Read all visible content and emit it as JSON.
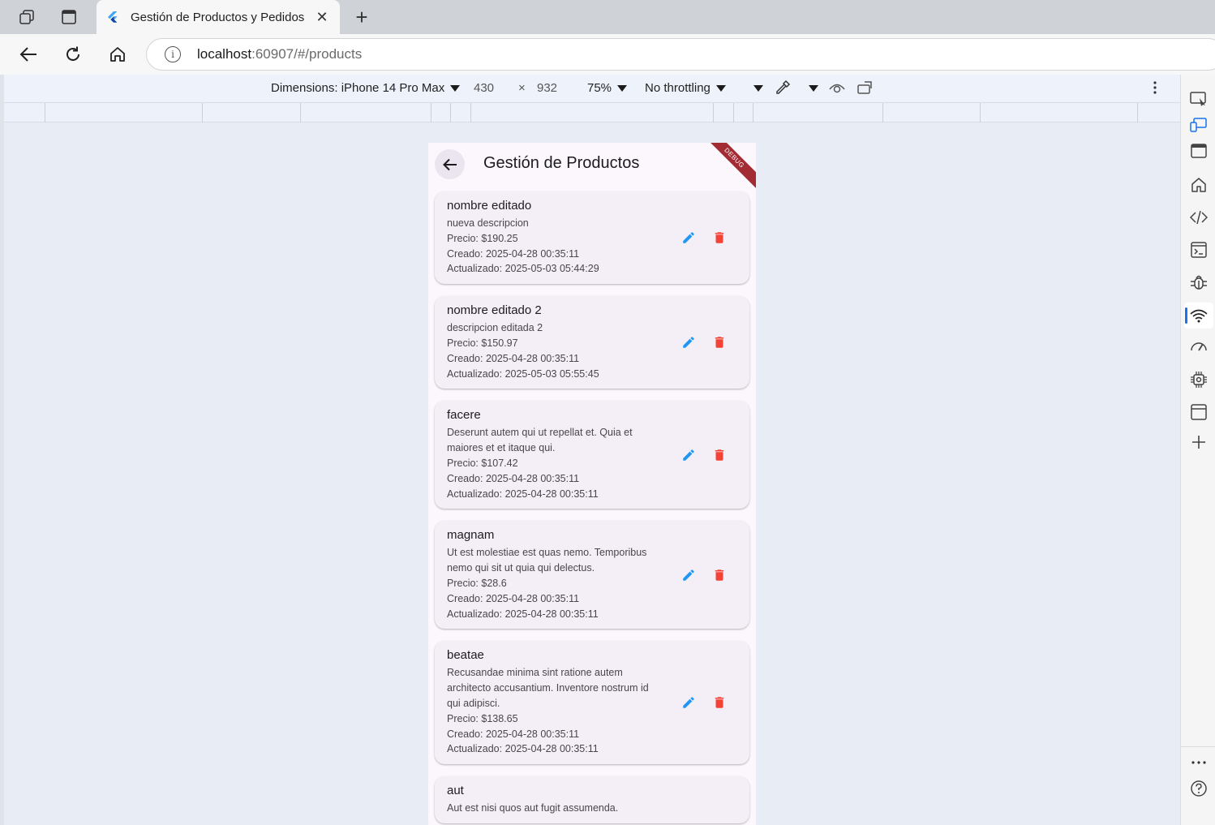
{
  "browser": {
    "tab_title": "Gestión de Productos y Pedidos",
    "url_host": "localhost",
    "url_rest": ":60907/#/products",
    "close_glyph": "✕"
  },
  "devtools": {
    "dimensions_label": "Dimensions: iPhone 14 Pro Max",
    "width": "430",
    "times": "×",
    "height": "932",
    "zoom": "75%",
    "throttling": "No throttling"
  },
  "app": {
    "title": "Gestión de Productos",
    "debug_label": "DEBUG",
    "products": [
      {
        "name": "nombre editado",
        "lines": [
          "nueva descripcion",
          "Precio: $190.25",
          "Creado: 2025-04-28 00:35:11",
          "Actualizado: 2025-05-03 05:44:29"
        ]
      },
      {
        "name": "nombre editado 2",
        "lines": [
          "descripcion editada 2",
          "Precio: $150.97",
          "Creado: 2025-04-28 00:35:11",
          "Actualizado: 2025-05-03 05:55:45"
        ]
      },
      {
        "name": "facere",
        "lines": [
          "Deserunt autem qui ut repellat et. Quia et maiores et et itaque qui.",
          "Precio: $107.42",
          "Creado: 2025-04-28 00:35:11",
          "Actualizado: 2025-04-28 00:35:11"
        ]
      },
      {
        "name": "magnam",
        "lines": [
          "Ut est molestiae est quas nemo. Temporibus nemo qui sit ut quia qui delectus.",
          "Precio: $28.6",
          "Creado: 2025-04-28 00:35:11",
          "Actualizado: 2025-04-28 00:35:11"
        ]
      },
      {
        "name": "beatae",
        "lines": [
          "Recusandae minima sint ratione autem architecto accusantium. Inventore nostrum id qui adipisci.",
          "Precio: $138.65",
          "Creado: 2025-04-28 00:35:11",
          "Actualizado: 2025-04-28 00:35:11"
        ]
      },
      {
        "name": "aut",
        "lines": [
          "Aut est nisi quos aut fugit assumenda."
        ]
      }
    ]
  },
  "colors": {
    "edit": "#2196f3",
    "delete": "#f44336",
    "debug_banner": "#a32c34"
  }
}
